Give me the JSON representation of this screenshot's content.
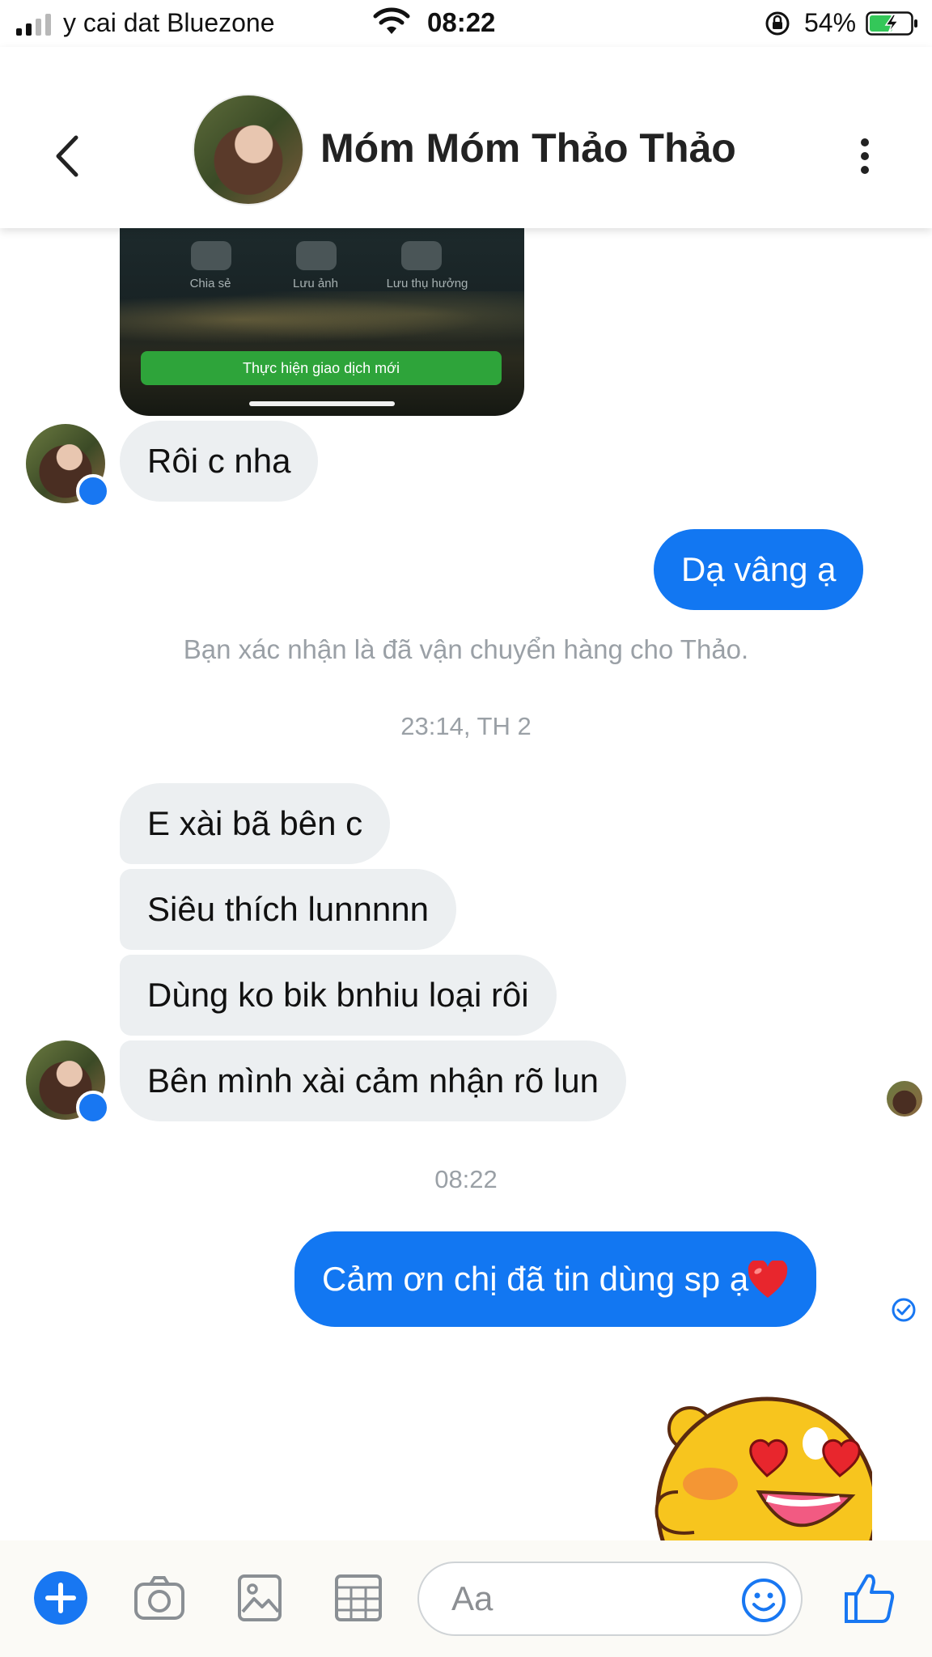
{
  "status_bar": {
    "carrier": "y cai dat Bluezone",
    "time": "08:22",
    "battery": "54%"
  },
  "header": {
    "contact_name": "Móm Móm Thảo Thảo"
  },
  "shared_image": {
    "actions": [
      "Chia sẻ",
      "Lưu ảnh",
      "Lưu thụ hưởng"
    ],
    "button_label": "Thực hiện giao dịch mới"
  },
  "messages": {
    "m1": "Rôi c nha",
    "m2": "Dạ vâng ạ",
    "system_note": "Bạn xác nhận là đã vận chuyển hàng cho Thảo.",
    "timestamp1": "23:14, TH 2",
    "m3": "E xài bã bên c",
    "m4": "Siêu thích lunnnnn",
    "m5": "Dùng ko bik bnhiu loại rôi",
    "m6": "Bên mình xài cảm nhận rõ lun",
    "timestamp2": "08:22",
    "m7": "Cảm ơn chị đã tin dùng sp ạ"
  },
  "composer": {
    "placeholder": "Aa"
  },
  "colors": {
    "accent": "#1877f2",
    "incoming_bubble": "#eceff1",
    "outgoing_bubble": "#1277f2"
  },
  "icons": [
    "back-icon",
    "more-icon",
    "messenger-icon",
    "plus-icon",
    "camera-icon",
    "image-icon",
    "gallery-icon",
    "smile-icon",
    "thumbs-up-icon",
    "heart-icon"
  ]
}
